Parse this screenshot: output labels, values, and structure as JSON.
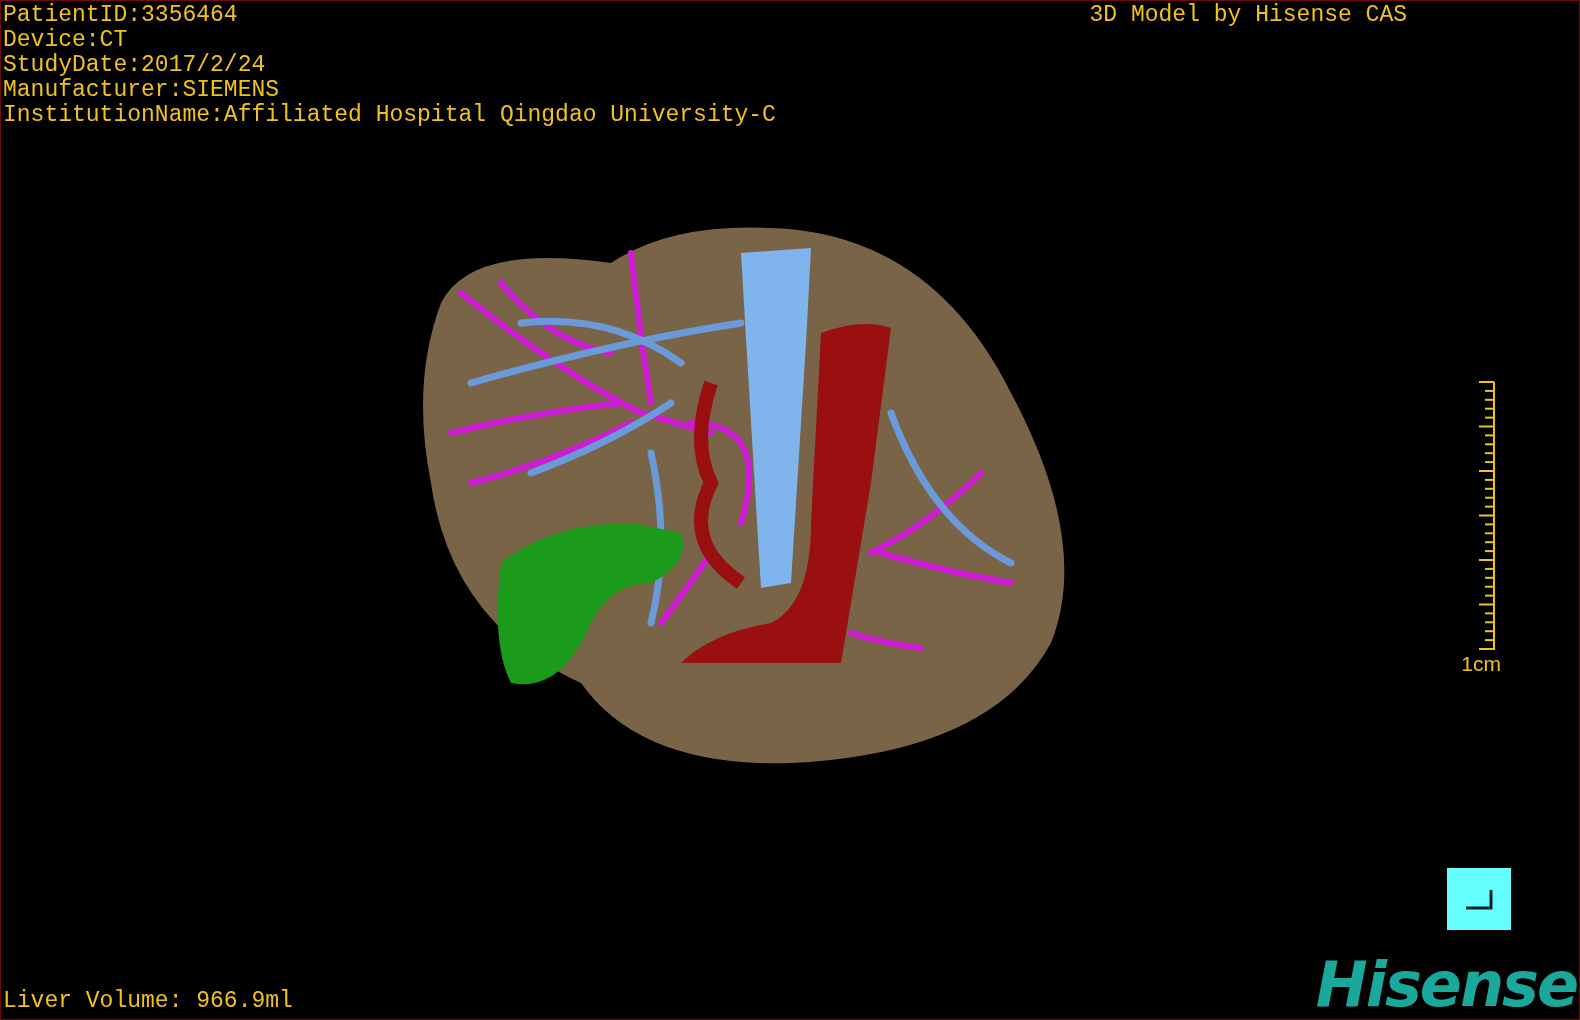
{
  "overlay": {
    "info_lines": [
      "PatientID:3356464",
      "Device:CT",
      "StudyDate:2017/2/24",
      "Manufacturer:SIEMENS",
      "InstitutionName:Affiliated Hospital Qingdao University-C"
    ],
    "title": "3D Model by Hisense CAS",
    "scale_bar": {
      "label": "1cm"
    },
    "liver_volume": "Liver Volume: 966.9ml"
  },
  "logo": {
    "text": "Hisense"
  }
}
